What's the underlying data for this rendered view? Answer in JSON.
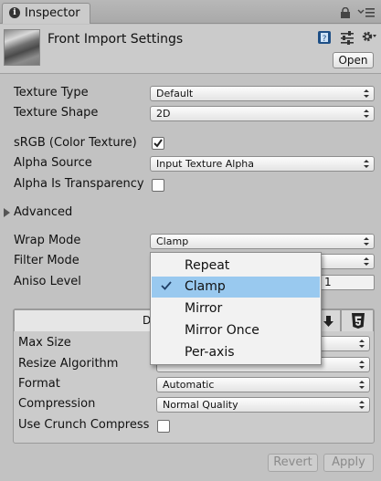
{
  "tab": {
    "icon": "info-icon",
    "label": "Inspector"
  },
  "window_icons": [
    "lock-icon",
    "menu-icon"
  ],
  "header": {
    "title": "Front Import Settings",
    "icons": [
      "help-book-icon",
      "preset-sliders-icon",
      "gear-icon"
    ],
    "open_label": "Open"
  },
  "fields": {
    "texture_type": {
      "label": "Texture Type",
      "value": "Default"
    },
    "texture_shape": {
      "label": "Texture Shape",
      "value": "2D"
    },
    "srgb": {
      "label": "sRGB (Color Texture)",
      "checked": true
    },
    "alpha_source": {
      "label": "Alpha Source",
      "value": "Input Texture Alpha"
    },
    "alpha_is_transparency": {
      "label": "Alpha Is Transparency",
      "checked": false
    },
    "advanced": {
      "label": "Advanced",
      "expanded": false
    },
    "wrap_mode": {
      "label": "Wrap Mode",
      "value": "Clamp"
    },
    "filter_mode": {
      "label": "Filter Mode",
      "value": ""
    },
    "aniso_level": {
      "label": "Aniso Level",
      "value": "1"
    }
  },
  "platform": {
    "default_tab_label": "D",
    "tab_icons": [
      "download-icon",
      "html5-icon"
    ],
    "max_size": {
      "label": "Max Size",
      "value": ""
    },
    "resize_algorithm": {
      "label": "Resize Algorithm",
      "value": ""
    },
    "format": {
      "label": "Format",
      "value": "Automatic"
    },
    "compression": {
      "label": "Compression",
      "value": "Normal Quality"
    },
    "crunch": {
      "label": "Use Crunch Compress",
      "checked": false
    }
  },
  "footer": {
    "revert_label": "Revert",
    "apply_label": "Apply"
  },
  "popup": {
    "items": [
      "Repeat",
      "Clamp",
      "Mirror",
      "Mirror Once",
      "Per-axis"
    ],
    "selected": "Clamp"
  },
  "colors": {
    "selection": "#99c9ef",
    "background": "#c2c2c2"
  }
}
